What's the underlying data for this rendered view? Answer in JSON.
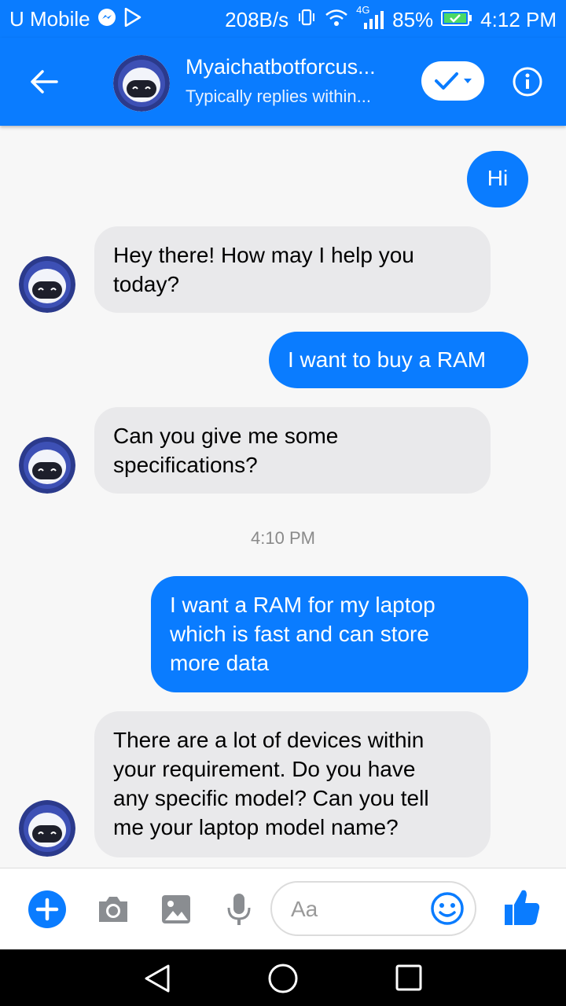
{
  "status_bar": {
    "carrier": "U Mobile",
    "speed": "208B/s",
    "network": "4G",
    "battery": "85%",
    "time": "4:12 PM"
  },
  "header": {
    "title": "Myaichatbotforcus...",
    "subtitle": "Typically replies within..."
  },
  "messages": [
    {
      "sender": "user",
      "text": "Hi"
    },
    {
      "sender": "bot",
      "lines": [
        "Hey there! How may I help you",
        "today?"
      ]
    },
    {
      "sender": "user",
      "text": "I want to buy a RAM"
    },
    {
      "sender": "bot",
      "lines": [
        "Can you give me some",
        "specifications?"
      ]
    },
    {
      "sender": "user",
      "lines": [
        "I want a RAM for my laptop",
        "which is fast and can store",
        "more data"
      ]
    },
    {
      "sender": "bot",
      "lines": [
        "There are a lot of devices within",
        "your requirement. Do you have",
        "any specific model? Can you tell",
        "me your laptop model name?"
      ]
    }
  ],
  "timestamp": "4:10 PM",
  "composer": {
    "placeholder": "Aa"
  },
  "colors": {
    "accent": "#0a7cff",
    "incoming_bubble": "#e9e9eb",
    "background": "#f7f7f7"
  }
}
